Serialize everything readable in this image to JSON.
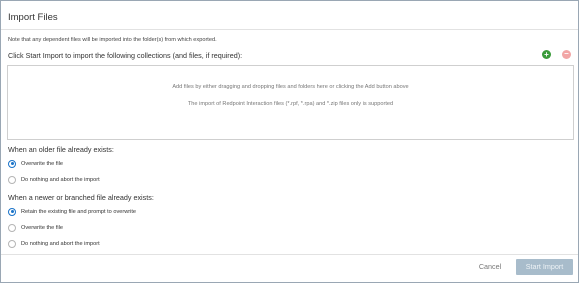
{
  "dialog": {
    "title": "Import Files",
    "note": "Note that any dependent files will be imported into the folder(s) from which exported.",
    "instruction": "Click Start Import to import the following collections (and files, if required):",
    "add_icon": "plus-circle-icon",
    "remove_icon": "minus-circle-icon",
    "colors": {
      "add": "#3a9b3a",
      "remove": "#f2a6a6",
      "radio_selected": "#1a73c9",
      "start_disabled": "#a8bccb"
    }
  },
  "dropzone": {
    "line1": "Add files by either dragging and dropping files and folders here or clicking the Add button above",
    "line2": "The import of Redpoint Interaction files (*.rpf, *.rpa) and *.zip files only is supported"
  },
  "older_section": {
    "label": "When an older file already exists:",
    "options": [
      {
        "label": "Overwrite the file",
        "selected": true
      },
      {
        "label": "Do nothing and abort the import",
        "selected": false
      }
    ]
  },
  "newer_section": {
    "label": "When a newer or branched file already exists:",
    "options": [
      {
        "label": "Retain the existing file and prompt to overwrite",
        "selected": true
      },
      {
        "label": "Overwrite the file",
        "selected": false
      },
      {
        "label": "Do nothing and abort the import",
        "selected": false
      }
    ]
  },
  "footer": {
    "cancel_label": "Cancel",
    "start_label": "Start Import"
  }
}
